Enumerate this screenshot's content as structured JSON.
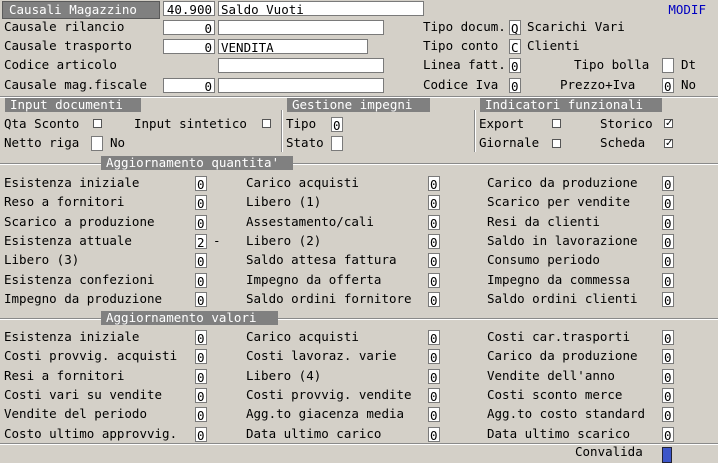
{
  "header": {
    "title": "Causali Magazzino",
    "code": "40.900",
    "description": "Saldo Vuoti",
    "mode": "MODIF"
  },
  "top": {
    "causale_rilancio": {
      "label": "Causale rilancio",
      "value": "0",
      "desc": ""
    },
    "causale_trasporto": {
      "label": "Causale trasporto",
      "value": "0",
      "desc": "VENDITA"
    },
    "codice_articolo": {
      "label": "Codice  articolo",
      "desc": ""
    },
    "causale_fiscale": {
      "label": "Causale mag.fiscale",
      "value": "0",
      "desc": ""
    },
    "tipo_docum": {
      "label": "Tipo docum.",
      "value": "Q",
      "desc": "Scarichi Vari"
    },
    "tipo_conto": {
      "label": "Tipo conto",
      "value": "C",
      "desc": "Clienti"
    },
    "linea_fatt": {
      "label": "Linea fatt.",
      "value": "0"
    },
    "tipo_bolla": {
      "label": "Tipo bolla",
      "value": "",
      "suffix": "Dt"
    },
    "codice_iva": {
      "label": "Codice Iva",
      "value": "0"
    },
    "prezzo_iva": {
      "label": "Prezzo+Iva",
      "value": "0",
      "suffix": "No"
    }
  },
  "input_documenti": {
    "title": "Input documenti",
    "qta_sconto": {
      "label": "Qta Sconto",
      "checked": ""
    },
    "input_sintetico": {
      "label": "Input sintetico",
      "checked": ""
    },
    "netto_riga": {
      "label": "Netto riga",
      "value": "",
      "suffix": "No"
    }
  },
  "gestione_impegni": {
    "title": "Gestione impegni",
    "tipo": {
      "label": "Tipo",
      "value": "0"
    },
    "stato": {
      "label": "Stato",
      "value": ""
    }
  },
  "indicatori": {
    "title": "Indicatori funzionali",
    "export": {
      "label": "Export",
      "checked": ""
    },
    "storico": {
      "label": "Storico",
      "checked": "✓"
    },
    "giornale": {
      "label": "Giornale",
      "checked": ""
    },
    "scheda": {
      "label": "Scheda",
      "checked": "✓"
    }
  },
  "quantita": {
    "title": "Aggiornamento quantita'",
    "col1": [
      {
        "label": "Esistenza iniziale",
        "value": "0"
      },
      {
        "label": "Reso    a fornitori",
        "value": "0"
      },
      {
        "label": "Scarico a produzione",
        "value": "0"
      },
      {
        "label": "Esistenza attuale",
        "value": "2",
        "suffix": "-"
      },
      {
        "label": "Libero (3)",
        "value": "0"
      },
      {
        "label": "Esistenza confezioni",
        "value": "0"
      },
      {
        "label": "Impegno da produzione",
        "value": "0"
      }
    ],
    "col2": [
      {
        "label": "Carico acquisti",
        "value": "0"
      },
      {
        "label": "Libero (1)",
        "value": "0"
      },
      {
        "label": "Assestamento/cali",
        "value": "0"
      },
      {
        "label": "Libero (2)",
        "value": "0"
      },
      {
        "label": "Saldo attesa fattura",
        "value": "0"
      },
      {
        "label": "Impegno da offerta",
        "value": "0"
      },
      {
        "label": "Saldo ordini fornitore",
        "value": "0"
      }
    ],
    "col3": [
      {
        "label": "Carico da produzione",
        "value": "0"
      },
      {
        "label": "Scarico per vendite",
        "value": "0"
      },
      {
        "label": "Resi  da clienti",
        "value": "0"
      },
      {
        "label": "Saldo in lavorazione",
        "value": "0"
      },
      {
        "label": "Consumo periodo",
        "value": "0"
      },
      {
        "label": "Impegno da commessa",
        "value": "0"
      },
      {
        "label": "Saldo ordini clienti",
        "value": "0"
      }
    ]
  },
  "valori": {
    "title": "Aggiornamento valori",
    "col1": [
      {
        "label": "Esistenza iniziale",
        "value": "0"
      },
      {
        "label": "Costi provvig. acquisti",
        "value": "0"
      },
      {
        "label": "Resi a fornitori",
        "value": "0"
      },
      {
        "label": "Costi vari su vendite",
        "value": "0"
      },
      {
        "label": "Vendite del periodo",
        "value": "0"
      },
      {
        "label": "Costo ultimo approvvig.",
        "value": "0"
      }
    ],
    "col2": [
      {
        "label": "Carico acquisti",
        "value": "0"
      },
      {
        "label": "Costi lavoraz. varie",
        "value": "0"
      },
      {
        "label": "Libero (4)",
        "value": "0"
      },
      {
        "label": "Costi provvig. vendite",
        "value": "0"
      },
      {
        "label": "Agg.to giacenza media",
        "value": "0"
      },
      {
        "label": "Data ultimo carico",
        "value": "0"
      }
    ],
    "col3": [
      {
        "label": "Costi  car.trasporti",
        "value": "0"
      },
      {
        "label": "Carico da produzione",
        "value": "0"
      },
      {
        "label": "Vendite dell'anno",
        "value": "0"
      },
      {
        "label": "Costi sconto merce",
        "value": "0"
      },
      {
        "label": "Agg.to costo standard",
        "value": "0"
      },
      {
        "label": "Data ultimo scarico",
        "value": "0"
      }
    ]
  },
  "footer": {
    "convalida_label": "Convalida"
  },
  "colors": {
    "background": "#d4d0c8",
    "section_bg": "#808080",
    "mode_text": "#0000c0",
    "confirm_box": "#3c55c8"
  }
}
